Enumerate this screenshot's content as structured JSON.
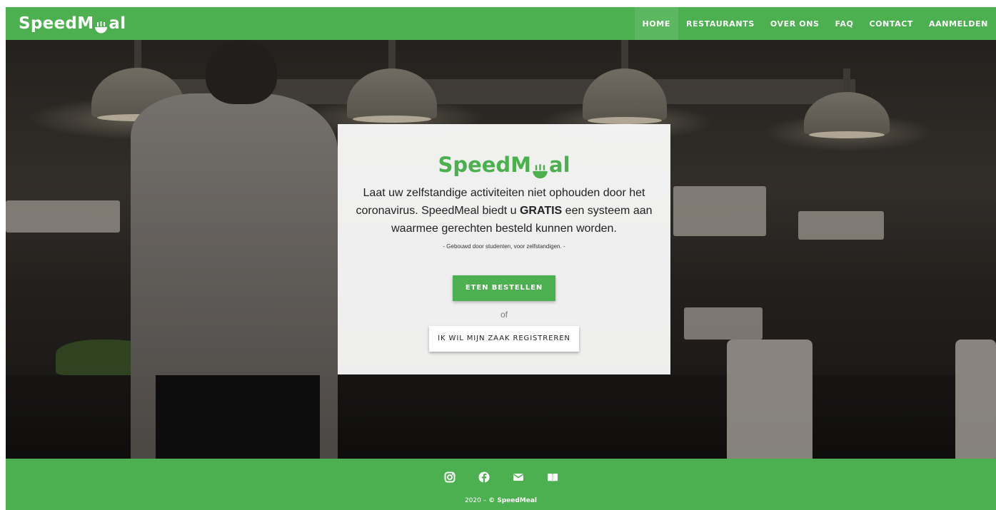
{
  "brand": {
    "prefix": "SpeedM",
    "suffix": "al"
  },
  "nav": {
    "items": [
      {
        "label": "HOME"
      },
      {
        "label": "RESTAURANTS"
      },
      {
        "label": "OVER ONS"
      },
      {
        "label": "FAQ"
      },
      {
        "label": "CONTACT"
      },
      {
        "label": "AANMELDEN"
      }
    ]
  },
  "hero": {
    "text_before": "Laat uw zelfstandige activiteiten niet ophouden door het coronavirus. SpeedMeal biedt u ",
    "text_bold": "GRATIS",
    "text_after": " een systeem aan waarmee gerechten besteld kunnen worden.",
    "subtitle": "- Gebouwd door studenten, voor zelfstandigen. -",
    "primary_button": "ETEN BESTELLEN",
    "or_text": "of",
    "secondary_button": "IK WIL MIJN ZAAK REGISTREREN"
  },
  "footer": {
    "icons": [
      "instagram-icon",
      "facebook-icon",
      "mail-icon",
      "book-icon"
    ],
    "year": "2020 –",
    "copyright": "© SpeedMeal"
  },
  "colors": {
    "brand_green": "#4caf50",
    "nav_active": "#5cb860",
    "card_bg": "#ffffff"
  }
}
